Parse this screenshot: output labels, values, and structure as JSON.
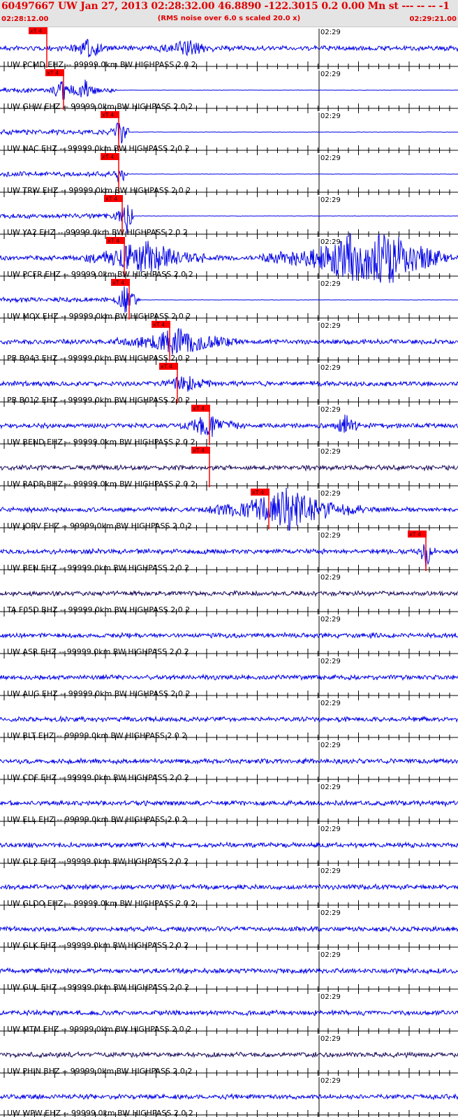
{
  "header": {
    "title": "60497667 UW Jan 27, 2013 02:28:32.00   46.8890 -122.3015  0.2 0.00 Mn st --- -- --  -1",
    "rms_note": "(RMS noise over 6.0 s scaled 20.0 x)",
    "time_start": "02:28:12.00",
    "time_end": "02:29:21.00"
  },
  "minute_label": "02:29",
  "pick_label": "xT 4",
  "colors": {
    "header_text": "#e00000",
    "header_bg": "#e4e4e4",
    "trace": "#0000e6",
    "trace_dark": "#1a0a5a",
    "pick": "#ff0000",
    "axis": "#000000"
  },
  "traces": [
    {
      "label": "UW PCMD EHZ -- 99999.0km BW  HIGHPASS  2.0  2",
      "color": "trace",
      "pick": true
    },
    {
      "label": "UW GHW EHZ -- 99999.0km BW  HIGHPASS  2.0  2",
      "color": "trace",
      "pick": true
    },
    {
      "label": "UW NAC EHZ -- 99999.0km BW  HIGHPASS  2.0  2",
      "color": "trace",
      "pick": true
    },
    {
      "label": "UW TRW EHZ -- 99999.0km BW  HIGHPASS  2.0  2",
      "color": "trace",
      "pick": true
    },
    {
      "label": "UW YA2 EHZ -- 99999.0km BW  HIGHPASS  2.0  2",
      "color": "trace",
      "pick": true
    },
    {
      "label": "UW PCFR EHZ -- 99999.0km BW  HIGHPASS  2.0  2",
      "color": "trace",
      "pick": true
    },
    {
      "label": "UW MOX EHZ -- 99999.0km BW  HIGHPASS  2.0  2",
      "color": "trace",
      "pick": true
    },
    {
      "label": "PB B943 EHZ -- 99999.0km BW  HIGHPASS  2.0  2",
      "color": "trace",
      "pick": true
    },
    {
      "label": "PB B012 EHZ -- 99999.0km BW  HIGHPASS  2.0  2",
      "color": "trace",
      "pick": true
    },
    {
      "label": "UW BEND EHZ -- 99999.0km BW  HIGHPASS  2.0  2",
      "color": "trace",
      "pick": true
    },
    {
      "label": "UW RADR BHZ -- 99999.0km BW  HIGHPASS  2.0  2",
      "color": "trace_dark",
      "pick": true
    },
    {
      "label": "UW JORV EHZ -- 99999.0km BW  HIGHPASS  2.0  2",
      "color": "trace",
      "pick": true
    },
    {
      "label": "UW BEN EHZ -- 99999.0km BW  HIGHPASS  2.0  2",
      "color": "trace",
      "pick": true
    },
    {
      "label": "TA F05D BHZ -- 99999.0km BW  HIGHPASS  2.0  2",
      "color": "trace_dark",
      "pick": false
    },
    {
      "label": "UW ASR EHZ -- 99999.0km BW  HIGHPASS  2.0  2",
      "color": "trace",
      "pick": false
    },
    {
      "label": "UW AUG EHZ -- 99999.0km BW  HIGHPASS  2.0  2",
      "color": "trace",
      "pick": false
    },
    {
      "label": "UW BLT EHZ -- 99999.0km BW  HIGHPASS  2.0  2",
      "color": "trace",
      "pick": false
    },
    {
      "label": "UW CDF EHZ -- 99999.0km BW  HIGHPASS  2.0  2",
      "color": "trace",
      "pick": false
    },
    {
      "label": "UW ELL EHZ -- 99999.0km BW  HIGHPASS  2.0  2",
      "color": "trace",
      "pick": false
    },
    {
      "label": "UW GL2 EHZ -- 99999.0km BW  HIGHPASS  2.0  2",
      "color": "trace",
      "pick": false
    },
    {
      "label": "UW GLDO EHZ -- 99999.0km BW  HIGHPASS  2.0  2",
      "color": "trace",
      "pick": false
    },
    {
      "label": "UW GLK EHZ -- 99999.0km BW  HIGHPASS  2.0  2",
      "color": "trace",
      "pick": false
    },
    {
      "label": "UW GUL EHZ -- 99999.0km BW  HIGHPASS  2.0  2",
      "color": "trace",
      "pick": false
    },
    {
      "label": "UW MTM EHZ -- 99999.0km BW  HIGHPASS  2.0  2",
      "color": "trace",
      "pick": false
    },
    {
      "label": "UW PHIN BHZ -- 99999.0km BW  HIGHPASS  2.0  2",
      "color": "trace_dark",
      "pick": false
    },
    {
      "label": "UW WPW EHZ -- 99999.0km BW  HIGHPASS  2.0  2",
      "color": "trace",
      "pick": false
    }
  ]
}
